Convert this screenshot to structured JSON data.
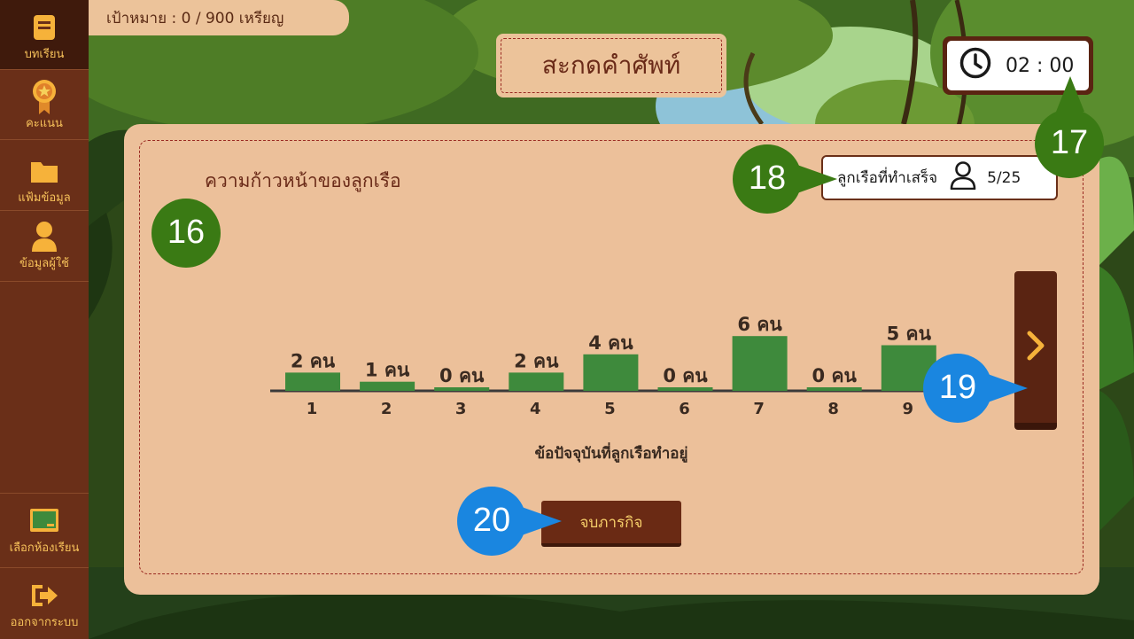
{
  "sidebar": {
    "items": [
      {
        "label": "บทเรียน",
        "icon": "book-icon",
        "active": true
      },
      {
        "label": "คะแนน",
        "icon": "medal-icon",
        "active": false
      },
      {
        "label": "แฟ้มข้อมูล",
        "icon": "folder-icon",
        "active": false
      },
      {
        "label": "ข้อมูลผู้ใช้",
        "icon": "user-icon",
        "active": false
      }
    ],
    "bottom_items": [
      {
        "label": "เลือกห้องเรียน",
        "icon": "classroom-board-icon"
      },
      {
        "label": "ออกจากระบบ",
        "icon": "logout-icon"
      }
    ]
  },
  "goal": {
    "text": "เป้าหมาย : 0 / 900 เหรียญ"
  },
  "title": "สะกดคำศัพท์",
  "timer": {
    "value": "02 : 00",
    "icon": "clock-icon"
  },
  "panel": {
    "progress_title": "ความก้าวหน้าของลูกเรือ",
    "completed": {
      "label": "ลูกเรือที่ทำเสร็จ",
      "icon": "person-icon",
      "value": "5/25"
    },
    "caption": "ข้อปัจจุบันที่ลูกเรือทำอยู่",
    "next_icon": "chevron-right-icon",
    "finish_button": "จบภารกิจ"
  },
  "chart_data": {
    "type": "bar",
    "categories": [
      "1",
      "2",
      "3",
      "4",
      "5",
      "6",
      "7",
      "8",
      "9"
    ],
    "values": [
      2,
      1,
      0,
      2,
      4,
      0,
      6,
      0,
      5
    ],
    "value_labels": [
      "2 คน",
      "1 คน",
      "0 คน",
      "2 คน",
      "4 คน",
      "0 คน",
      "6 คน",
      "0 คน",
      "5 คน"
    ],
    "xlabel": "ข้อปัจจุบันที่ลูกเรือทำอยู่",
    "ylabel": "",
    "bar_color": "#3e8a3c",
    "grid": false
  },
  "callouts": [
    {
      "number": "16",
      "color": "#3a7a14"
    },
    {
      "number": "17",
      "color": "#3a7a14"
    },
    {
      "number": "18",
      "color": "#3a7a14"
    },
    {
      "number": "19",
      "color": "#1a86e0"
    },
    {
      "number": "20",
      "color": "#1a86e0"
    }
  ],
  "colors": {
    "sidebar": "#6a2f18",
    "accent_text": "#f6c15a",
    "panel": "#ecc09a",
    "dash": "#9a2a22",
    "button": "#6a2a14"
  }
}
